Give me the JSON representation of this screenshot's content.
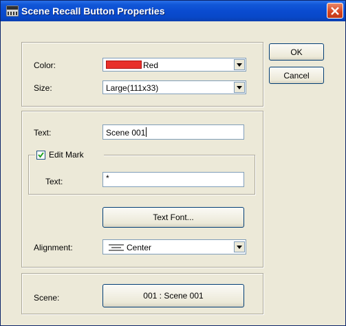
{
  "window": {
    "title": "Scene Recall Button Properties",
    "app_icon": "dme-app-icon",
    "close_icon": "close-icon"
  },
  "buttons": {
    "ok": "OK",
    "cancel": "Cancel",
    "text_font": "Text Font...",
    "scene": "001 : Scene 001"
  },
  "appearance": {
    "color_label": "Color:",
    "color_value": "Red",
    "color_hex": "#e8302a",
    "size_label": "Size:",
    "size_value": "Large(111x33)"
  },
  "text_settings": {
    "text_label": "Text:",
    "text_value": "Scene 001",
    "edit_mark_label": "Edit Mark",
    "edit_mark_checked": true,
    "mark_text_label": "Text:",
    "mark_text_value": "*",
    "alignment_label": "Alignment:",
    "alignment_value": "Center",
    "alignment_icon": "align-center-icon"
  },
  "scene": {
    "label": "Scene:"
  }
}
